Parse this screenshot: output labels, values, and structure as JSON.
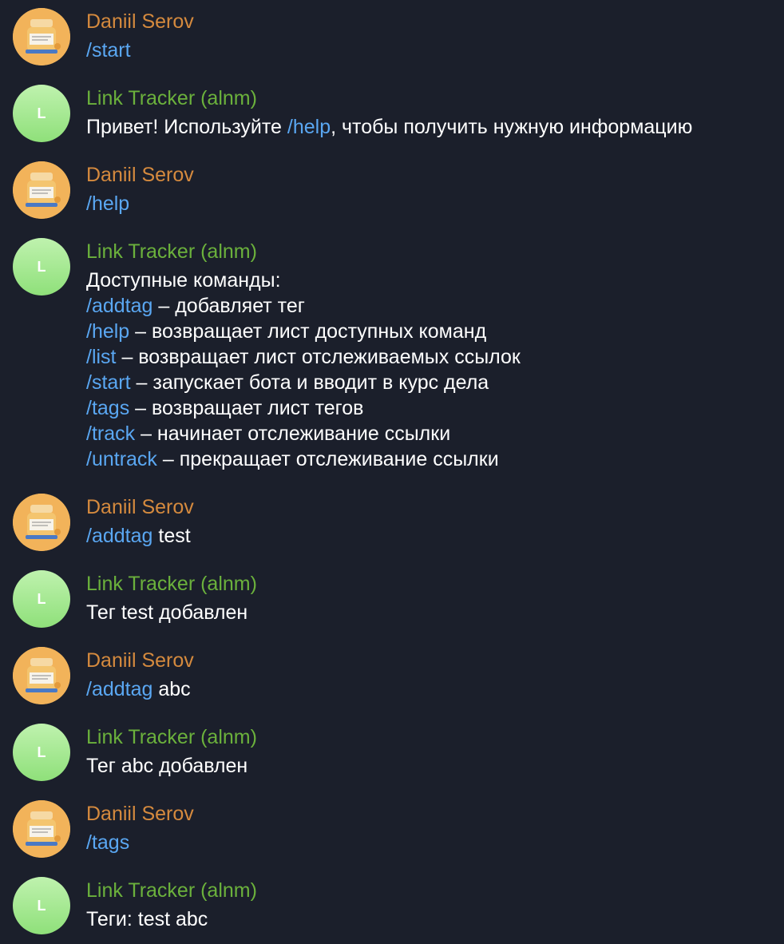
{
  "colors": {
    "background": "#1b1f2b",
    "user_name": "#d58a3e",
    "bot_name": "#6bb13c",
    "command": "#5aa7f2",
    "text": "#ffffff"
  },
  "bot_avatar_letter": "L",
  "user_avatar_icon": "cat-sticker-avatar",
  "messages": [
    {
      "sender": "Daniil Serov",
      "lines": [
        {
          "cmd": "/start",
          "text": ""
        }
      ]
    },
    {
      "sender": "Link Tracker (alnm)",
      "lines": [
        {
          "pre": "Привет! Используйте ",
          "cmd": "/help",
          "text": ", чтобы получить нужную информацию"
        }
      ]
    },
    {
      "sender": "Daniil Serov",
      "lines": [
        {
          "cmd": "/help",
          "text": ""
        }
      ]
    },
    {
      "sender": "Link Tracker (alnm)",
      "lines": [
        {
          "pre": "Доступные команды:",
          "cmd": "",
          "text": ""
        },
        {
          "cmd": "/addtag",
          "text": " – добавляет тег"
        },
        {
          "cmd": "/help",
          "text": " – возвращает лист доступных команд"
        },
        {
          "cmd": "/list",
          "text": " – возвращает лист отслеживаемых ссылок"
        },
        {
          "cmd": "/start",
          "text": " – запускает бота и вводит в курс дела"
        },
        {
          "cmd": "/tags",
          "text": " – возвращает лист тегов"
        },
        {
          "cmd": "/track",
          "text": " – начинает отслеживание ссылки"
        },
        {
          "cmd": "/untrack",
          "text": " – прекращает отслеживание ссылки"
        }
      ]
    },
    {
      "sender": "Daniil Serov",
      "lines": [
        {
          "cmd": "/addtag",
          "text": " test"
        }
      ]
    },
    {
      "sender": "Link Tracker (alnm)",
      "lines": [
        {
          "pre": "Тег test добавлен",
          "cmd": "",
          "text": ""
        }
      ]
    },
    {
      "sender": "Daniil Serov",
      "lines": [
        {
          "cmd": "/addtag",
          "text": " abc"
        }
      ]
    },
    {
      "sender": "Link Tracker (alnm)",
      "lines": [
        {
          "pre": "Тег abc добавлен",
          "cmd": "",
          "text": ""
        }
      ]
    },
    {
      "sender": "Daniil Serov",
      "lines": [
        {
          "cmd": "/tags",
          "text": ""
        }
      ]
    },
    {
      "sender": "Link Tracker (alnm)",
      "lines": [
        {
          "pre": "Теги: test abc",
          "cmd": "",
          "text": ""
        }
      ]
    }
  ]
}
